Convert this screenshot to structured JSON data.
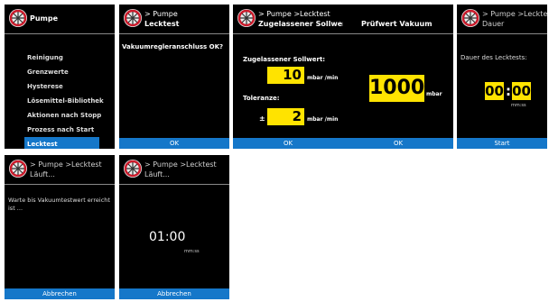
{
  "s1": {
    "title": "Pumpe",
    "menu": [
      "Reinigung",
      "Grenzwerte",
      "Hysterese",
      "Lösemittel-Bibliothek",
      "Aktionen nach Stopp",
      "Prozess nach Start",
      "Lecktest"
    ]
  },
  "s2": {
    "crumb": "> Pumpe",
    "title": "Lecktest",
    "question": "Vakuumregleranschluss OK?",
    "button": "OK"
  },
  "s3": {
    "crumb": "> Pumpe >Lecktest",
    "title": "Zugelassener Sollwert",
    "sollwert_label": "Zugelassener Sollwert:",
    "sollwert_value": "10",
    "sollwert_unit": "mbar /min",
    "toleranz_label": "Toleranze:",
    "toleranz_prefix": "±",
    "toleranz_value": "2",
    "toleranz_unit": "mbar /min",
    "button": "OK"
  },
  "s4": {
    "title": "Prüfwert Vakuum",
    "value": "1000",
    "unit": "mbar",
    "button": "OK"
  },
  "s5": {
    "crumb": "> Pumpe >Lecktest",
    "title": "Dauer",
    "label": "Dauer des Lecktests:",
    "minutes": "00",
    "sep": ":",
    "seconds": "00",
    "format": "mm:ss",
    "button": "Start"
  },
  "s6": {
    "crumb": "> Pumpe >Lecktest",
    "title": "Läuft...",
    "message": "Warte bis Vakuumtestwert erreicht ist ...",
    "button": "Abbrechen"
  },
  "s7": {
    "crumb": "> Pumpe >Lecktest",
    "title": "Läuft...",
    "timer": "01:00",
    "format": "mm:ss",
    "button": "Abbrechen"
  },
  "colors": {
    "accent": "#1577c9",
    "highlight": "#ffe300",
    "logo_ring": "#cc1a2b"
  },
  "icons": {
    "logo": "pump-logo-icon"
  }
}
